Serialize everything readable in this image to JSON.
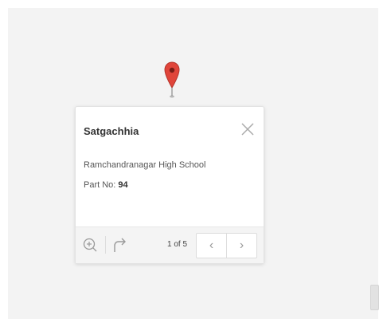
{
  "popup": {
    "title": "Satgachhia",
    "school": "Ramchandranagar High School",
    "part_label": "Part No:",
    "part_value": "94",
    "pagination": "1 of 5",
    "prev_glyph": "‹",
    "next_glyph": "›"
  },
  "colors": {
    "marker": "#e0453a",
    "map_background": "#f3f3f3"
  },
  "icons": [
    "map-pin-icon",
    "close-icon",
    "zoom-in-icon",
    "share-icon",
    "chevron-left-icon",
    "chevron-right-icon"
  ]
}
